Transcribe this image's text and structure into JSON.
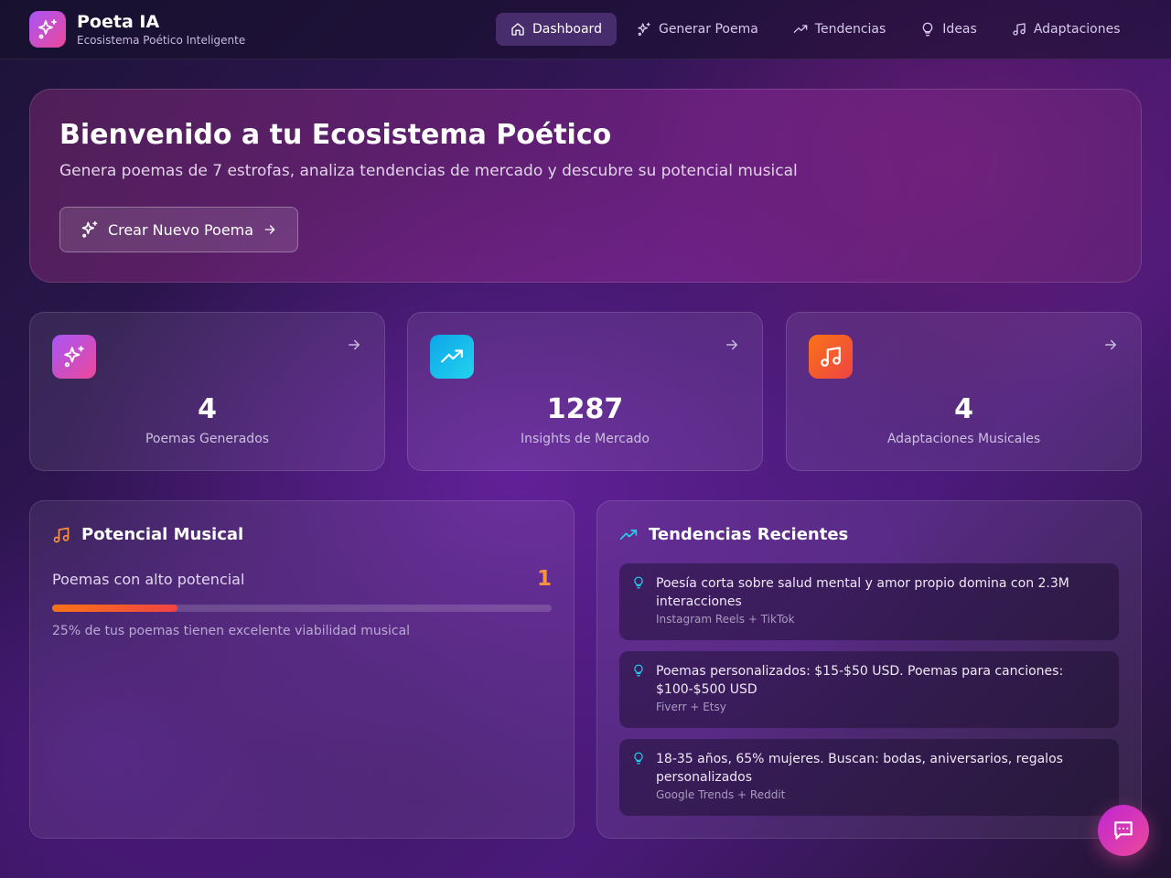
{
  "brand": {
    "title": "Poeta IA",
    "subtitle": "Ecosistema Poético Inteligente",
    "icon": "sparkles-icon"
  },
  "nav": {
    "active": "Dashboard",
    "items": [
      {
        "label": "Dashboard",
        "icon": "home-icon"
      },
      {
        "label": "Generar Poema",
        "icon": "sparkles-icon"
      },
      {
        "label": "Tendencias",
        "icon": "trending-up-icon"
      },
      {
        "label": "Ideas",
        "icon": "lightbulb-icon"
      },
      {
        "label": "Adaptaciones",
        "icon": "music-icon"
      }
    ]
  },
  "hero": {
    "title": "Bienvenido a tu Ecosistema Poético",
    "subtitle": "Genera poemas de 7 estrofas, analiza tendencias de mercado y descubre su potencial musical",
    "button_label": "Crear Nuevo Poema"
  },
  "stats": [
    {
      "value": "4",
      "label": "Poemas Generados",
      "icon": "sparkles-icon",
      "color": "#c026d3"
    },
    {
      "value": "1287",
      "label": "Insights de Mercado",
      "icon": "trending-up-icon",
      "color": "#0ea5e9"
    },
    {
      "value": "4",
      "label": "Adaptaciones Musicales",
      "icon": "music-icon",
      "color": "#f97316"
    }
  ],
  "musical_potential": {
    "title": "Potencial Musical",
    "label": "Poemas con alto potencial",
    "count": "1",
    "progress_fraction": 0.25,
    "note": "25% de tus poemas tienen excelente viabilidad musical"
  },
  "trends": {
    "title": "Tendencias Recientes",
    "items": [
      {
        "text": "Poesía corta sobre salud mental y amor propio domina con 2.3M interacciones",
        "source": "Instagram Reels + TikTok"
      },
      {
        "text": "Poemas personalizados: $15-$50 USD. Poemas para canciones: $100-$500 USD",
        "source": "Fiverr + Etsy"
      },
      {
        "text": "18-35 años, 65% mujeres. Buscan: bodas, aniversarios, regalos personalizados",
        "source": "Google Trends + Reddit"
      }
    ]
  },
  "chat": {
    "icon": "chat-icon"
  },
  "colors": {
    "accent_orange": "#fb923c",
    "accent_cyan": "#22d3ee",
    "brand_gradient": "#a855f7"
  }
}
